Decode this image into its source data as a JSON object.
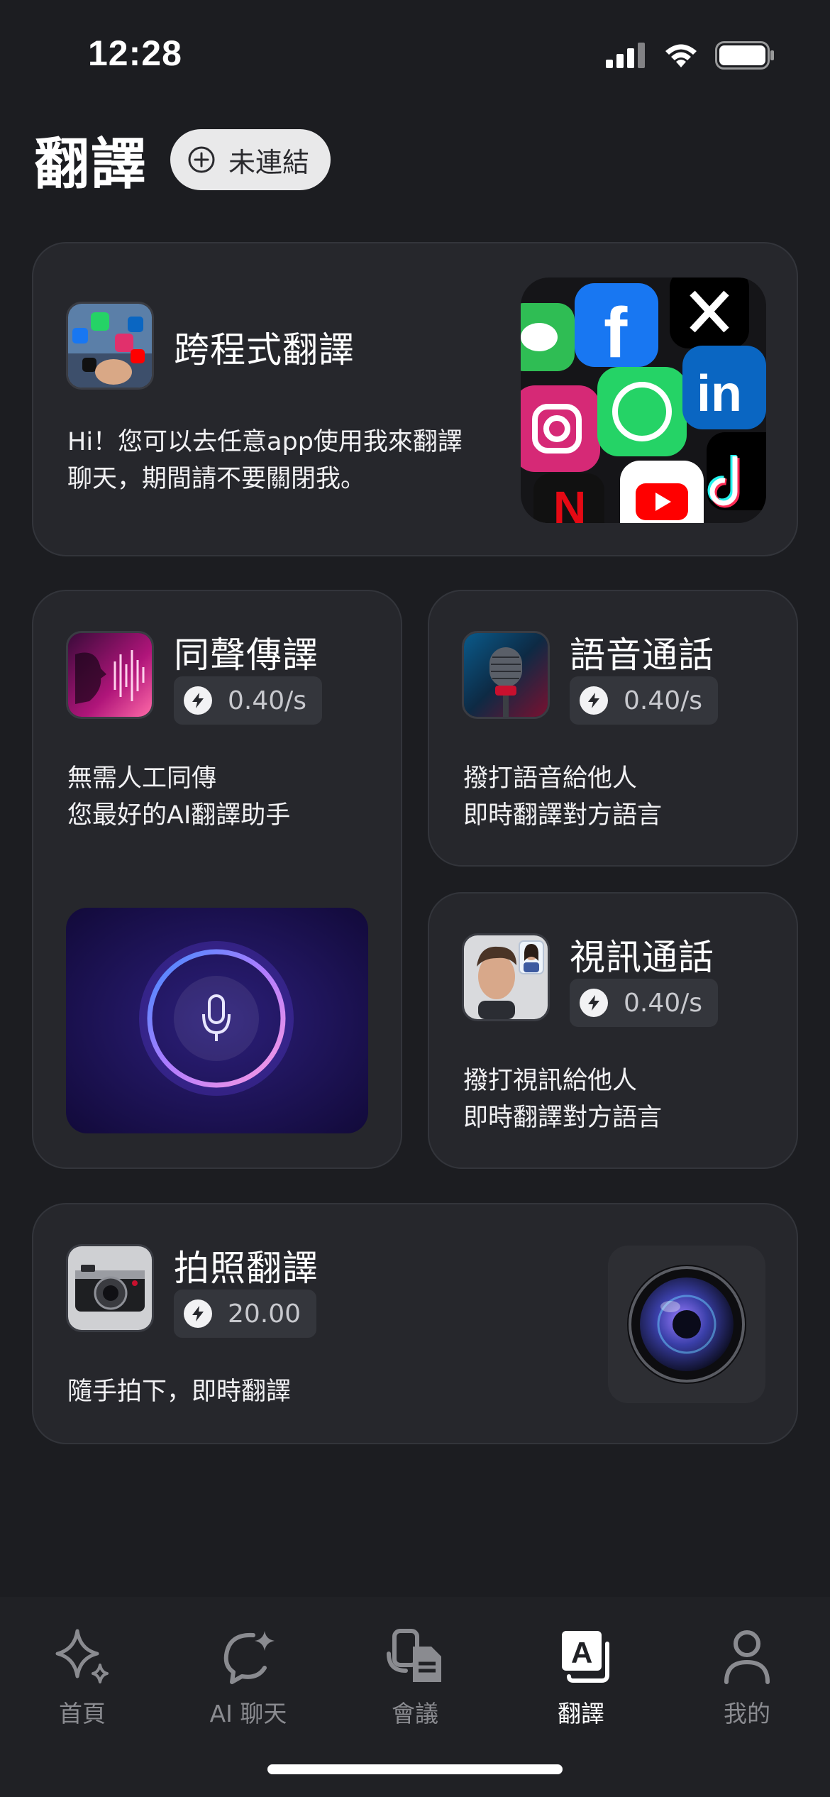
{
  "status": {
    "time": "12:28"
  },
  "header": {
    "title": "翻譯",
    "connection_label": "未連結"
  },
  "cards": {
    "cross_app": {
      "title": "跨程式翻譯",
      "desc_lines": [
        "Hi！您可以去任意app使用我來翻譯",
        "聊天，期間請不要關閉我。"
      ]
    },
    "simul": {
      "title": "同聲傳譯",
      "price": "0.40/s",
      "desc_lines": [
        "無需人工同傳",
        "您最好的AI翻譯助手"
      ]
    },
    "voice_call": {
      "title": "語音通話",
      "price": "0.40/s",
      "desc_lines": [
        "撥打語音給他人",
        "即時翻譯對方語言"
      ]
    },
    "video_call": {
      "title": "視訊通話",
      "price": "0.40/s",
      "desc_lines": [
        "撥打視訊給他人",
        "即時翻譯對方語言"
      ]
    },
    "photo": {
      "title": "拍照翻譯",
      "price": "20.00",
      "desc_lines": [
        "隨手拍下，即時翻譯"
      ]
    }
  },
  "tabbar": {
    "items": [
      {
        "label": "首頁",
        "icon": "sparkle-icon"
      },
      {
        "label": "AI 聊天",
        "icon": "ai-chat-icon"
      },
      {
        "label": "會議",
        "icon": "meeting-icon"
      },
      {
        "label": "翻譯",
        "icon": "translate-icon",
        "active": true
      },
      {
        "label": "我的",
        "icon": "profile-icon"
      }
    ]
  },
  "colors": {
    "background": "#1c1d21",
    "card": "#26272c",
    "chip": "#34363c",
    "active_tab": "#ffffff",
    "inactive_tab": "#8a8b90"
  }
}
